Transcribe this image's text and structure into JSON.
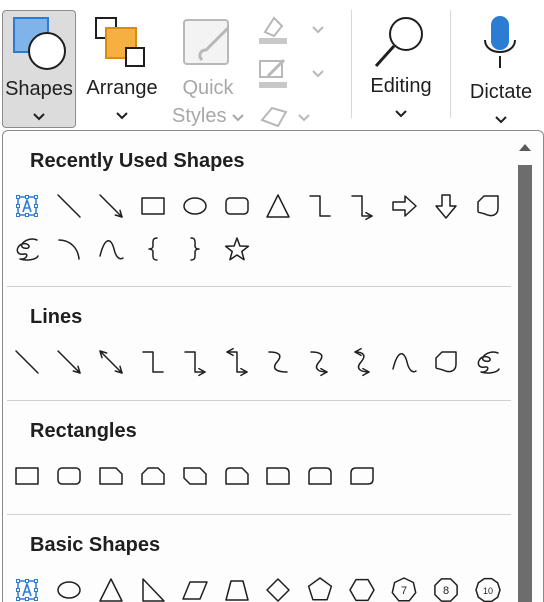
{
  "ribbon": {
    "shapes": {
      "label": "Shapes"
    },
    "arrange": {
      "label": "Arrange"
    },
    "quick_styles": {
      "line1": "Quick",
      "line2": "Styles"
    },
    "editing": {
      "label": "Editing"
    },
    "dictate": {
      "label": "Dictate"
    }
  },
  "gallery": {
    "sections": [
      {
        "title": "Recently Used Shapes",
        "shapes": [
          "text-box",
          "line",
          "arrow-line",
          "rectangle",
          "oval",
          "rounded-rectangle",
          "triangle",
          "elbow-connector",
          "elbow-arrow-connector",
          "block-arrow-right",
          "block-arrow-down",
          "flowchart-card",
          "freeform-scribble",
          "arc",
          "curve",
          "left-brace",
          "right-brace",
          "star-5-point"
        ]
      },
      {
        "title": "Lines",
        "shapes": [
          "line",
          "line-arrow",
          "line-double-arrow",
          "elbow-connector",
          "elbow-arrow-connector",
          "elbow-double-arrow-connector",
          "curved-connector",
          "curved-arrow-connector",
          "curved-double-arrow-connector",
          "curve",
          "freeform-shape",
          "freeform-scribble"
        ]
      },
      {
        "title": "Rectangles",
        "shapes": [
          "rectangle",
          "rounded-rectangle",
          "snip-single-corner-rectangle",
          "snip-same-side-corner-rectangle",
          "snip-diagonal-corner-rectangle",
          "snip-round-single-corner-rectangle",
          "round-single-corner-rectangle",
          "round-same-side-corner-rectangle",
          "round-diagonal-corner-rectangle"
        ]
      },
      {
        "title": "Basic Shapes",
        "shapes": [
          "text-box",
          "oval",
          "isosceles-triangle",
          "right-triangle",
          "parallelogram",
          "trapezoid",
          "diamond",
          "pentagon",
          "hexagon",
          "heptagon",
          "octagon",
          "decagon"
        ],
        "badges": {
          "heptagon": "7",
          "octagon": "8",
          "decagon": "10"
        }
      }
    ]
  },
  "colors": {
    "accent": "#2b7cd3",
    "fill_blue": "#7fb4ea",
    "fill_orange": "#f5b041",
    "scroll_thumb": "#6d6d6d"
  }
}
